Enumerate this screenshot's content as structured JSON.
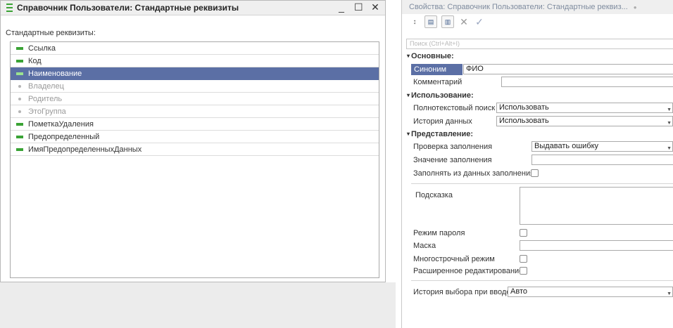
{
  "window": {
    "title": "Справочник Пользователи: Стандартные реквизиты",
    "minimize": "_",
    "maximize": "☐",
    "close": "✕",
    "subtitle": "Стандартные реквизиты:"
  },
  "attributes": [
    {
      "label": "Ссылка",
      "state": "enabled"
    },
    {
      "label": "Код",
      "state": "enabled"
    },
    {
      "label": "Наименование",
      "state": "selected"
    },
    {
      "label": "Владелец",
      "state": "disabled"
    },
    {
      "label": "Родитель",
      "state": "disabled"
    },
    {
      "label": "ЭтоГруппа",
      "state": "disabled"
    },
    {
      "label": "ПометкаУдаления",
      "state": "enabled"
    },
    {
      "label": "Предопределенный",
      "state": "enabled"
    },
    {
      "label": "ИмяПредопределенныхДанных",
      "state": "enabled"
    }
  ],
  "properties": {
    "title": "Свойства: Справочник Пользователи: Стандартные реквиз...",
    "search_placeholder": "Поиск (Ctrl+Alt+I)",
    "sections": {
      "main": "Основные:",
      "usage": "Использование:",
      "view": "Представление:"
    },
    "synonym_label": "Синоним",
    "synonym_value": "ФИО",
    "comment_label": "Комментарий",
    "comment_value": "",
    "fulltext_label": "Полнотекстовый поиск",
    "fulltext_value": "Использовать",
    "history_label": "История данных",
    "history_value": "Использовать",
    "fill_check_label": "Проверка заполнения",
    "fill_check_value": "Выдавать ошибку",
    "fill_value_label": "Значение заполнения",
    "fill_from_data_label": "Заполнять из данных заполнения",
    "tooltip_label": "Подсказка",
    "password_mode_label": "Режим пароля",
    "mask_label": "Маска",
    "multiline_label": "Многострочный режим",
    "extended_edit_label": "Расширенное редактирование",
    "choice_history_label": "История выбора при вводе",
    "choice_history_value": "Авто"
  },
  "colors": {
    "accent": "#5b6fa5",
    "green": "#3aa335"
  }
}
